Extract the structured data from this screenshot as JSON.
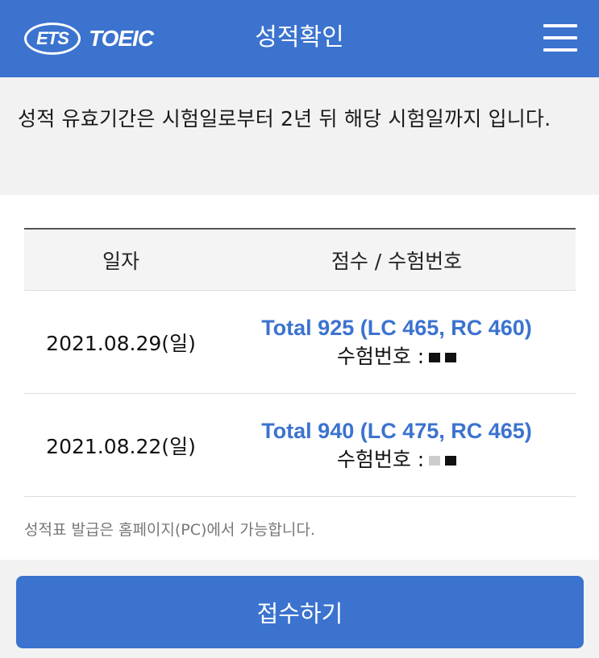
{
  "header": {
    "logo_ets": "ETS",
    "logo_toeic": "TOEIC",
    "title": "성적확인"
  },
  "notice": {
    "text": "성적 유효기간은 시험일로부터 2년 뒤 해당 시험일까지 입니다."
  },
  "table": {
    "columns": [
      "일자",
      "점수 / 수험번호"
    ],
    "rows": [
      {
        "date": "2021.08.29(일)",
        "score": "Total 925 (LC 465, RC 460)",
        "reg_label": "수험번호 :"
      },
      {
        "date": "2021.08.22(일)",
        "score": "Total 940 (LC 475, RC 465)",
        "reg_label": "수험번호 :"
      }
    ]
  },
  "issue_note": "성적표 발급은 홈페이지(PC)에서 가능합니다.",
  "apply_button": "접수하기",
  "colors": {
    "primary": "#3b73cf"
  }
}
